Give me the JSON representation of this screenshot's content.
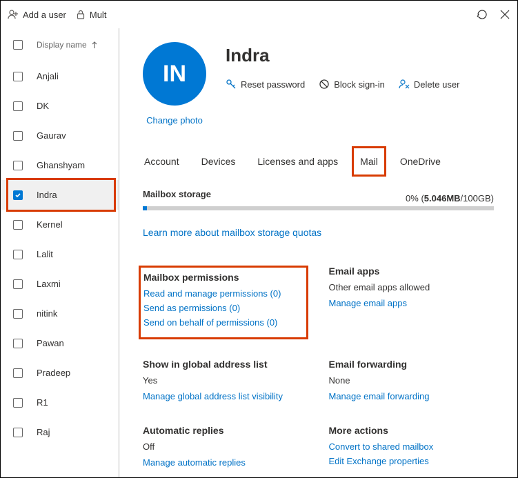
{
  "topbar": {
    "add_user": "Add a user",
    "multi_truncated": "Mult"
  },
  "list": {
    "header": "Display name",
    "users": [
      {
        "name": "Anjali",
        "selected": false
      },
      {
        "name": "DK",
        "selected": false
      },
      {
        "name": "Gaurav",
        "selected": false
      },
      {
        "name": "Ghanshyam",
        "selected": false
      },
      {
        "name": "Indra",
        "selected": true
      },
      {
        "name": "Kernel",
        "selected": false
      },
      {
        "name": "Lalit",
        "selected": false
      },
      {
        "name": "Laxmi",
        "selected": false
      },
      {
        "name": "nitink",
        "selected": false
      },
      {
        "name": "Pawan",
        "selected": false
      },
      {
        "name": "Pradeep",
        "selected": false
      },
      {
        "name": "R1",
        "selected": false
      },
      {
        "name": "Raj",
        "selected": false
      }
    ]
  },
  "detail": {
    "initials": "IN",
    "change_photo": "Change photo",
    "name": "Indra",
    "actions": {
      "reset_password": "Reset password",
      "block_signin": "Block sign-in",
      "delete_user": "Delete user"
    },
    "tabs": {
      "account": "Account",
      "devices": "Devices",
      "licenses": "Licenses and apps",
      "mail": "Mail",
      "onedrive": "OneDrive"
    },
    "storage": {
      "heading": "Mailbox storage",
      "percent": "0%",
      "used": "5.046MB",
      "total": "100GB",
      "learn_more": "Learn more about mailbox storage quotas"
    },
    "permissions": {
      "heading": "Mailbox permissions",
      "read_manage": "Read and manage permissions (0)",
      "send_as": "Send as permissions (0)",
      "send_on_behalf": "Send on behalf of permissions (0)"
    },
    "email_apps": {
      "heading": "Email apps",
      "status": "Other email apps allowed",
      "link": "Manage email apps"
    },
    "gal": {
      "heading": "Show in global address list",
      "value": "Yes",
      "link": "Manage global address list visibility"
    },
    "forwarding": {
      "heading": "Email forwarding",
      "value": "None",
      "link": "Manage email forwarding"
    },
    "auto_replies": {
      "heading": "Automatic replies",
      "value": "Off",
      "link": "Manage automatic replies"
    },
    "more_actions": {
      "heading": "More actions",
      "convert": "Convert to shared mailbox",
      "edit_exchange": "Edit Exchange properties"
    }
  }
}
